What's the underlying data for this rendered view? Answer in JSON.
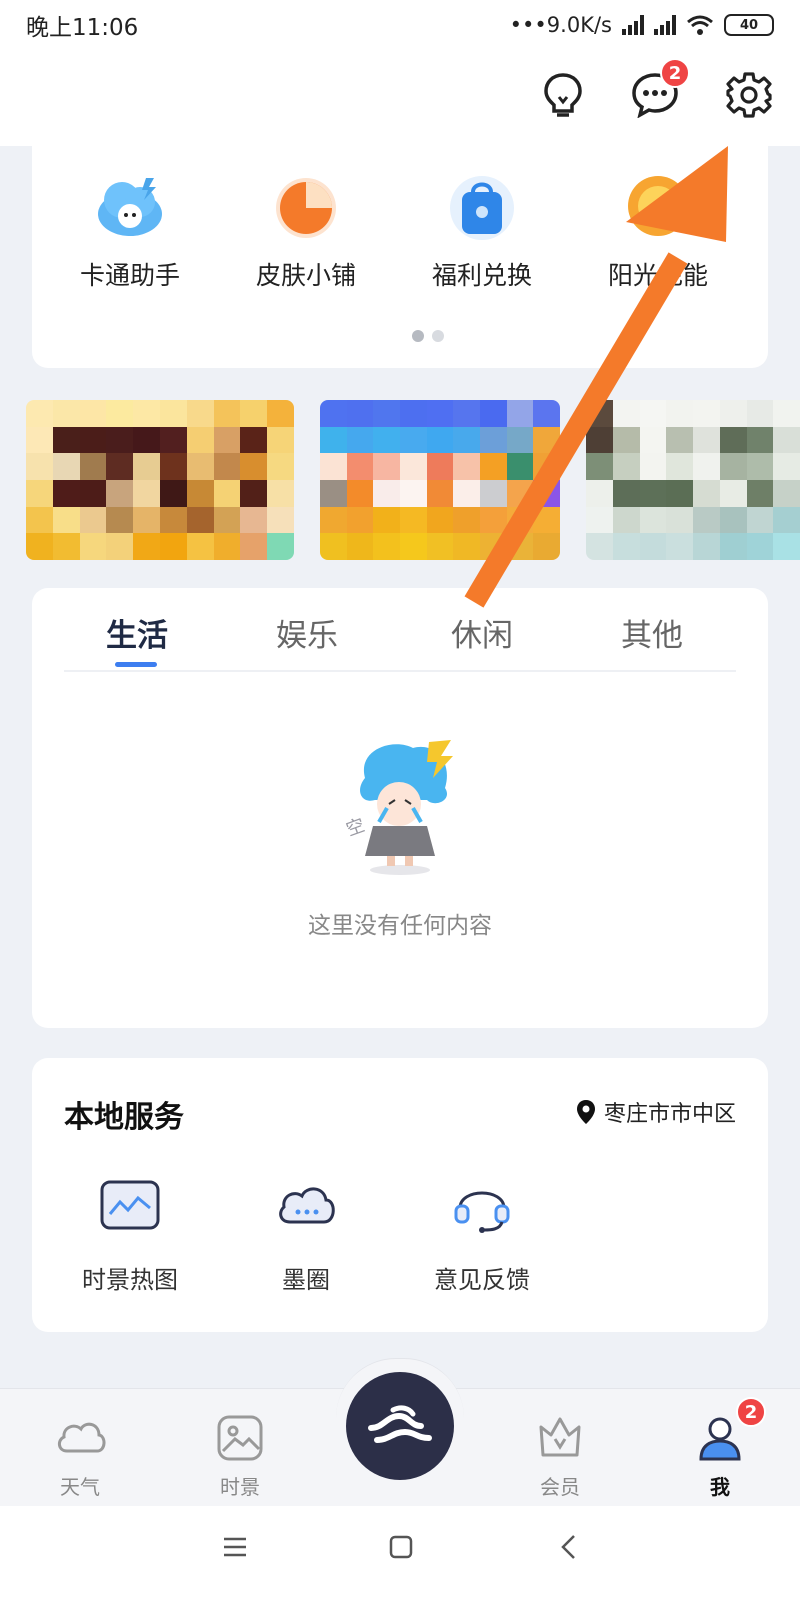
{
  "status_bar": {
    "time": "晚上11:06",
    "net_speed": "•••9.0K/s",
    "battery": "40"
  },
  "header": {
    "messages_badge": "2"
  },
  "tools": [
    {
      "label": "卡通助手",
      "icon": "cartoon-assistant-icon"
    },
    {
      "label": "皮肤小铺",
      "icon": "skin-shop-icon"
    },
    {
      "label": "福利兑换",
      "icon": "bag-icon"
    },
    {
      "label": "阳光充能",
      "icon": "sun-icon"
    }
  ],
  "tabs": [
    "生活",
    "娱乐",
    "休闲",
    "其他"
  ],
  "empty": {
    "text": "这里没有任何内容"
  },
  "local_services": {
    "title": "本地服务",
    "location": "枣庄市市中区",
    "items": [
      {
        "label": "时景热图",
        "icon": "image-chart-icon"
      },
      {
        "label": "墨圈",
        "icon": "cloud-dots-icon"
      },
      {
        "label": "意见反馈",
        "icon": "headset-icon"
      }
    ]
  },
  "nav": {
    "items": [
      "天气",
      "时景",
      "会员",
      "我"
    ],
    "me_badge": "2"
  },
  "colors": {
    "accent": "#3d7ef0",
    "badge": "#ef4444",
    "arrow": "#f47a2a",
    "center": "#2c2f48"
  }
}
